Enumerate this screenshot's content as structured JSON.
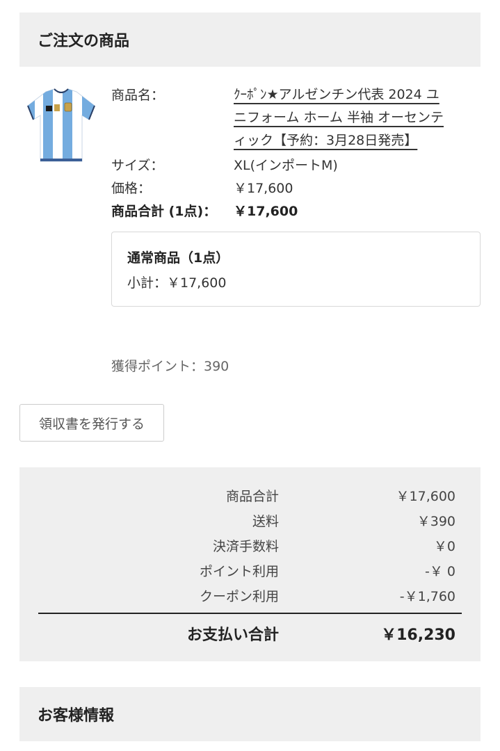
{
  "order_section": {
    "title": "ご注文の商品"
  },
  "product": {
    "name_label": "商品名：",
    "name_lines": [
      "ｸｰﾎﾟﾝ★アルゼンチン代表 2024 ユ",
      "ニフォーム ホーム 半袖 オーセンテ",
      "ィック【予約：3月28日発売】"
    ],
    "image_icon": "jersey-icon",
    "size_label": "サイズ：",
    "size_value": "XL(インポートM)",
    "price_label": "価格：",
    "price_value": "￥17,600",
    "item_total_label": "商品合計 (1点)：",
    "item_total_value": "￥17,600"
  },
  "subtotal_box": {
    "title": "通常商品（1点）",
    "line": "小計：￥17,600"
  },
  "points": {
    "text": "獲得ポイント：390"
  },
  "receipt_button": {
    "label": "領収書を発行する"
  },
  "totals": {
    "rows": [
      {
        "label": "商品合計",
        "value": "￥17,600"
      },
      {
        "label": "送料",
        "value": "￥390"
      },
      {
        "label": "決済手数料",
        "value": "￥0"
      },
      {
        "label": "ポイント利用",
        "value": "-￥ 0"
      },
      {
        "label": "クーポン利用",
        "value": "-￥1,760"
      }
    ],
    "grand_label": "お支払い合計",
    "grand_value": "￥16,230"
  },
  "customer_section": {
    "title": "お客様情報"
  },
  "colors": {
    "panel_bg": "#efefef",
    "jersey_blue": "#74acdf",
    "jersey_white": "#ffffff"
  }
}
